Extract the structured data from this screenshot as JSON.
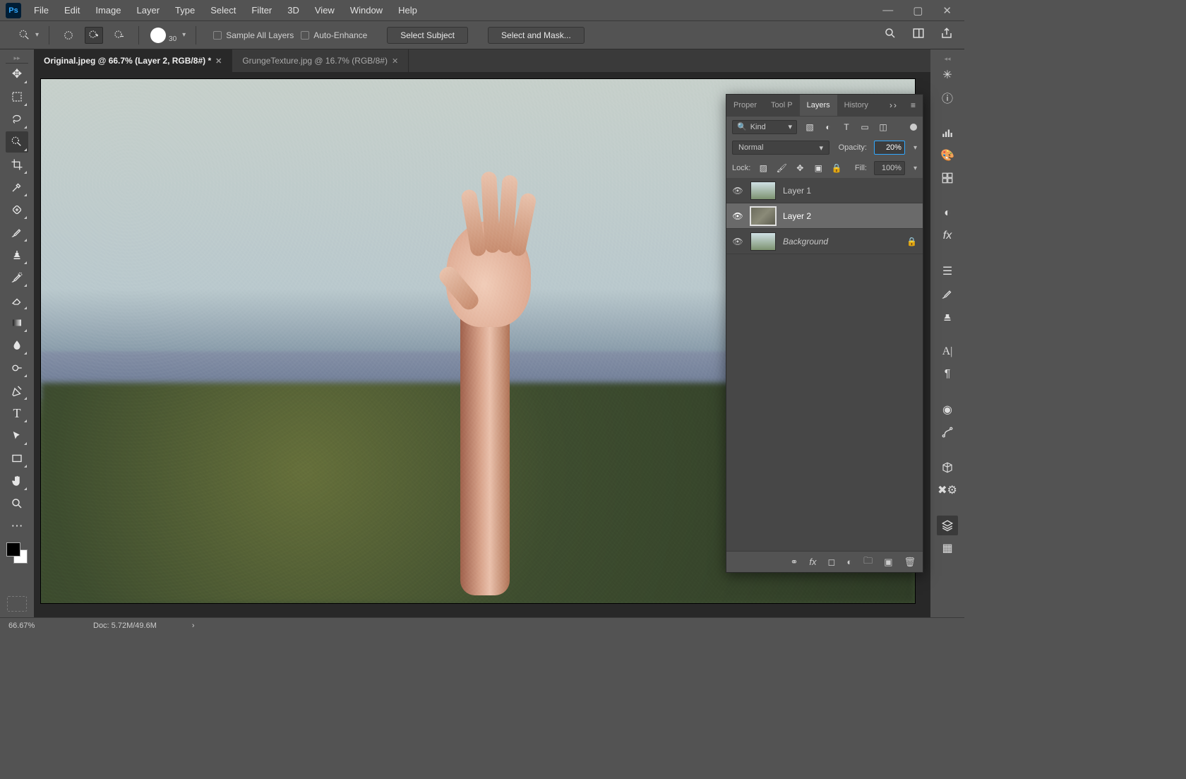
{
  "menu": [
    "File",
    "Edit",
    "Image",
    "Layer",
    "Type",
    "Select",
    "Filter",
    "3D",
    "View",
    "Window",
    "Help"
  ],
  "options": {
    "brush_size": "30",
    "sample_all_layers": "Sample All Layers",
    "auto_enhance": "Auto-Enhance",
    "select_subject": "Select Subject",
    "select_and_mask": "Select and Mask..."
  },
  "tabs": [
    {
      "label": "Original.jpeg @ 66.7% (Layer 2, RGB/8#) *",
      "active": true
    },
    {
      "label": "GrungeTexture.jpg @ 16.7% (RGB/8#)",
      "active": false
    }
  ],
  "layers_panel": {
    "tabs": [
      "Proper",
      "Tool P",
      "Layers",
      "History"
    ],
    "active_tab": "Layers",
    "kind_label": "Kind",
    "blend_mode": "Normal",
    "opacity_label": "Opacity:",
    "opacity_value": "20%",
    "lock_label": "Lock:",
    "fill_label": "Fill:",
    "fill_value": "100%",
    "layers": [
      {
        "name": "Layer 1",
        "locked": false,
        "selected": false,
        "thumb": "sky"
      },
      {
        "name": "Layer 2",
        "locked": false,
        "selected": true,
        "thumb": "grunge"
      },
      {
        "name": "Background",
        "locked": true,
        "selected": false,
        "italic": true,
        "thumb": "sky"
      }
    ]
  },
  "status": {
    "zoom": "66.67%",
    "doc": "Doc: 5.72M/49.6M"
  },
  "tool_tips": {
    "move": "move",
    "marquee": "rectangular-marquee",
    "lasso": "lasso",
    "quick-select": "quick-selection",
    "crop": "crop",
    "eyedrop": "eyedropper",
    "heal": "spot-healing",
    "brush": "brush",
    "stamp": "clone-stamp",
    "history": "history-brush",
    "eraser": "eraser",
    "gradient": "gradient",
    "blur": "blur",
    "dodge": "dodge",
    "pen": "pen",
    "type": "type",
    "path": "path-select",
    "rect": "rectangle",
    "hand": "hand",
    "zoom": "zoom",
    "more": "edit-toolbar"
  },
  "right_dock_groups": [
    [
      "compass-icon",
      "info-icon"
    ],
    [
      "histogram-icon",
      "color-icon",
      "swatches-icon"
    ],
    [
      "adjustments-icon",
      "styles-icon"
    ],
    [
      "layercomp-icon",
      "brush-settings-icon",
      "brush-presets-icon"
    ],
    [
      "character-icon",
      "paragraph-icon"
    ],
    [
      "channels-icon",
      "paths-icon"
    ],
    [
      "3d-icon",
      "properties-icon"
    ],
    [
      "layers-icon",
      "actions-icon"
    ]
  ]
}
